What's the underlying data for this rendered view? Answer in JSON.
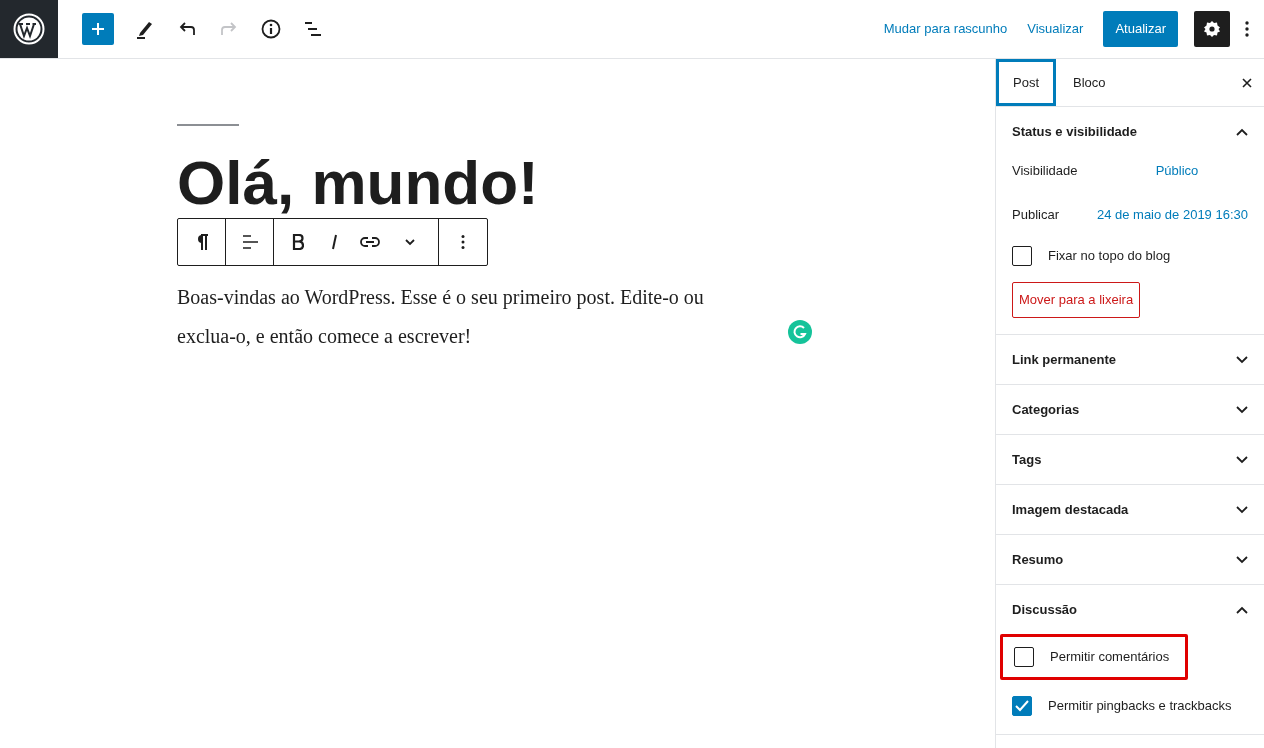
{
  "header": {
    "undo": {
      "disabled": false
    },
    "redo": {
      "disabled": true
    },
    "links": [
      "Mudar para rascunho",
      "Visualizar"
    ],
    "primary_button": "Atualizar",
    "settings_active": true
  },
  "editor": {
    "title": "Olá, mundo!",
    "paragraph": "Boas-vindas ao WordPress. Esse é o seu primeiro post. Edite-o ou exclua-o, e então comece a escrever!"
  },
  "sidebar": {
    "tabs": [
      {
        "label": "Post",
        "selected": true
      },
      {
        "label": "Bloco",
        "selected": false
      }
    ],
    "panels": [
      {
        "title": "Status e visibilidade",
        "expanded": true,
        "rows": [
          {
            "kind": "field",
            "label": "Visibilidade",
            "value": "Público"
          },
          {
            "kind": "field",
            "label": "Publicar",
            "value": "24 de maio de 2019 16:30"
          },
          {
            "kind": "checkbox",
            "label": "Fixar no topo do blog",
            "checked": false,
            "highlighted": false
          },
          {
            "kind": "button",
            "label": "Mover para a lixeira"
          }
        ]
      },
      {
        "title": "Link permanente",
        "expanded": false
      },
      {
        "title": "Categorias",
        "expanded": false
      },
      {
        "title": "Tags",
        "expanded": false
      },
      {
        "title": "Imagem destacada",
        "expanded": false
      },
      {
        "title": "Resumo",
        "expanded": false
      },
      {
        "title": "Discussão",
        "expanded": true,
        "rows": [
          {
            "kind": "checkbox",
            "label": "Permitir comentários",
            "checked": false,
            "highlighted": true
          },
          {
            "kind": "checkbox",
            "label": "Permitir pingbacks e trackbacks",
            "checked": true,
            "highlighted": false
          }
        ]
      }
    ]
  }
}
